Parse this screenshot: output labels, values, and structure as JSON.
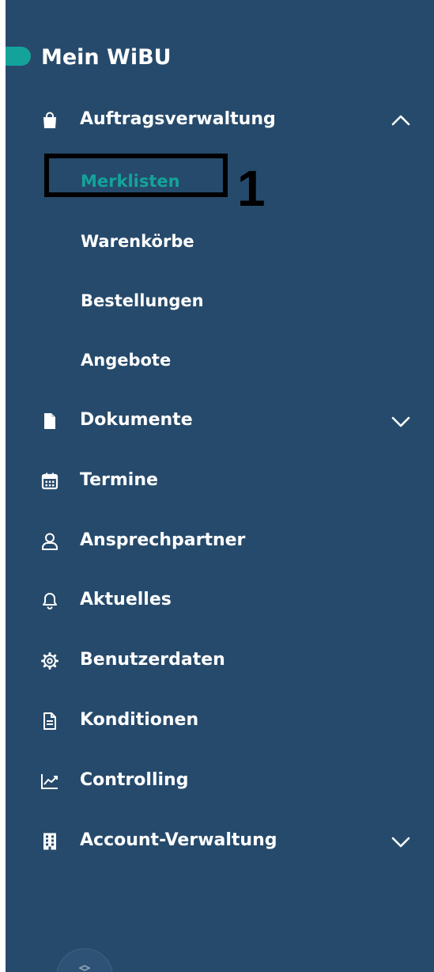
{
  "sidebar": {
    "title": "Mein WiBU",
    "accent_color": "#14a39b",
    "background_color": "#264a6b",
    "groups": [
      {
        "label": "Auftragsverwaltung",
        "icon": "shopping-bag-icon",
        "chevron": "chevron-up-icon",
        "expanded": true
      },
      {
        "label": "Dokumente",
        "icon": "document-icon",
        "chevron": "chevron-down-icon",
        "expanded": false
      },
      {
        "label": "Termine",
        "icon": "calendar-icon"
      },
      {
        "label": "Ansprechpartner",
        "icon": "user-icon"
      },
      {
        "label": "Aktuelles",
        "icon": "bell-icon"
      },
      {
        "label": "Benutzerdaten",
        "icon": "gear-icon"
      },
      {
        "label": "Konditionen",
        "icon": "file-lines-icon"
      },
      {
        "label": "Controlling",
        "icon": "chart-line-icon"
      },
      {
        "label": "Account-Verwaltung",
        "icon": "building-icon",
        "chevron": "chevron-down-icon",
        "expanded": false
      }
    ],
    "subitems": [
      {
        "label": "Merklisten",
        "active": true
      },
      {
        "label": "Warenkörbe",
        "active": false
      },
      {
        "label": "Bestellungen",
        "active": false
      },
      {
        "label": "Angebote",
        "active": false
      }
    ]
  },
  "annotation": {
    "number": "1"
  }
}
